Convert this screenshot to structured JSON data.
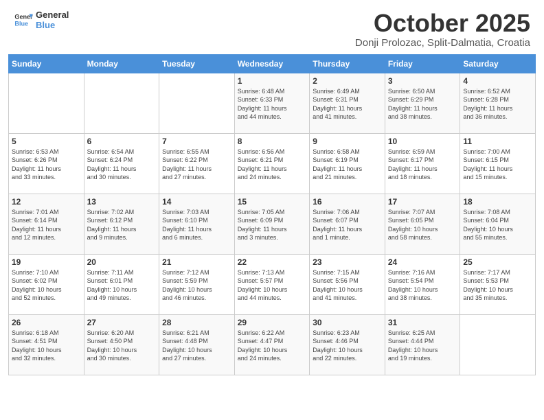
{
  "header": {
    "logo_general": "General",
    "logo_blue": "Blue",
    "month": "October 2025",
    "location": "Donji Prolozac, Split-Dalmatia, Croatia"
  },
  "days_of_week": [
    "Sunday",
    "Monday",
    "Tuesday",
    "Wednesday",
    "Thursday",
    "Friday",
    "Saturday"
  ],
  "weeks": [
    [
      {
        "day": "",
        "info": ""
      },
      {
        "day": "",
        "info": ""
      },
      {
        "day": "",
        "info": ""
      },
      {
        "day": "1",
        "info": "Sunrise: 6:48 AM\nSunset: 6:33 PM\nDaylight: 11 hours\nand 44 minutes."
      },
      {
        "day": "2",
        "info": "Sunrise: 6:49 AM\nSunset: 6:31 PM\nDaylight: 11 hours\nand 41 minutes."
      },
      {
        "day": "3",
        "info": "Sunrise: 6:50 AM\nSunset: 6:29 PM\nDaylight: 11 hours\nand 38 minutes."
      },
      {
        "day": "4",
        "info": "Sunrise: 6:52 AM\nSunset: 6:28 PM\nDaylight: 11 hours\nand 36 minutes."
      }
    ],
    [
      {
        "day": "5",
        "info": "Sunrise: 6:53 AM\nSunset: 6:26 PM\nDaylight: 11 hours\nand 33 minutes."
      },
      {
        "day": "6",
        "info": "Sunrise: 6:54 AM\nSunset: 6:24 PM\nDaylight: 11 hours\nand 30 minutes."
      },
      {
        "day": "7",
        "info": "Sunrise: 6:55 AM\nSunset: 6:22 PM\nDaylight: 11 hours\nand 27 minutes."
      },
      {
        "day": "8",
        "info": "Sunrise: 6:56 AM\nSunset: 6:21 PM\nDaylight: 11 hours\nand 24 minutes."
      },
      {
        "day": "9",
        "info": "Sunrise: 6:58 AM\nSunset: 6:19 PM\nDaylight: 11 hours\nand 21 minutes."
      },
      {
        "day": "10",
        "info": "Sunrise: 6:59 AM\nSunset: 6:17 PM\nDaylight: 11 hours\nand 18 minutes."
      },
      {
        "day": "11",
        "info": "Sunrise: 7:00 AM\nSunset: 6:15 PM\nDaylight: 11 hours\nand 15 minutes."
      }
    ],
    [
      {
        "day": "12",
        "info": "Sunrise: 7:01 AM\nSunset: 6:14 PM\nDaylight: 11 hours\nand 12 minutes."
      },
      {
        "day": "13",
        "info": "Sunrise: 7:02 AM\nSunset: 6:12 PM\nDaylight: 11 hours\nand 9 minutes."
      },
      {
        "day": "14",
        "info": "Sunrise: 7:03 AM\nSunset: 6:10 PM\nDaylight: 11 hours\nand 6 minutes."
      },
      {
        "day": "15",
        "info": "Sunrise: 7:05 AM\nSunset: 6:09 PM\nDaylight: 11 hours\nand 3 minutes."
      },
      {
        "day": "16",
        "info": "Sunrise: 7:06 AM\nSunset: 6:07 PM\nDaylight: 11 hours\nand 1 minute."
      },
      {
        "day": "17",
        "info": "Sunrise: 7:07 AM\nSunset: 6:05 PM\nDaylight: 10 hours\nand 58 minutes."
      },
      {
        "day": "18",
        "info": "Sunrise: 7:08 AM\nSunset: 6:04 PM\nDaylight: 10 hours\nand 55 minutes."
      }
    ],
    [
      {
        "day": "19",
        "info": "Sunrise: 7:10 AM\nSunset: 6:02 PM\nDaylight: 10 hours\nand 52 minutes."
      },
      {
        "day": "20",
        "info": "Sunrise: 7:11 AM\nSunset: 6:01 PM\nDaylight: 10 hours\nand 49 minutes."
      },
      {
        "day": "21",
        "info": "Sunrise: 7:12 AM\nSunset: 5:59 PM\nDaylight: 10 hours\nand 46 minutes."
      },
      {
        "day": "22",
        "info": "Sunrise: 7:13 AM\nSunset: 5:57 PM\nDaylight: 10 hours\nand 44 minutes."
      },
      {
        "day": "23",
        "info": "Sunrise: 7:15 AM\nSunset: 5:56 PM\nDaylight: 10 hours\nand 41 minutes."
      },
      {
        "day": "24",
        "info": "Sunrise: 7:16 AM\nSunset: 5:54 PM\nDaylight: 10 hours\nand 38 minutes."
      },
      {
        "day": "25",
        "info": "Sunrise: 7:17 AM\nSunset: 5:53 PM\nDaylight: 10 hours\nand 35 minutes."
      }
    ],
    [
      {
        "day": "26",
        "info": "Sunrise: 6:18 AM\nSunset: 4:51 PM\nDaylight: 10 hours\nand 32 minutes."
      },
      {
        "day": "27",
        "info": "Sunrise: 6:20 AM\nSunset: 4:50 PM\nDaylight: 10 hours\nand 30 minutes."
      },
      {
        "day": "28",
        "info": "Sunrise: 6:21 AM\nSunset: 4:48 PM\nDaylight: 10 hours\nand 27 minutes."
      },
      {
        "day": "29",
        "info": "Sunrise: 6:22 AM\nSunset: 4:47 PM\nDaylight: 10 hours\nand 24 minutes."
      },
      {
        "day": "30",
        "info": "Sunrise: 6:23 AM\nSunset: 4:46 PM\nDaylight: 10 hours\nand 22 minutes."
      },
      {
        "day": "31",
        "info": "Sunrise: 6:25 AM\nSunset: 4:44 PM\nDaylight: 10 hours\nand 19 minutes."
      },
      {
        "day": "",
        "info": ""
      }
    ]
  ]
}
